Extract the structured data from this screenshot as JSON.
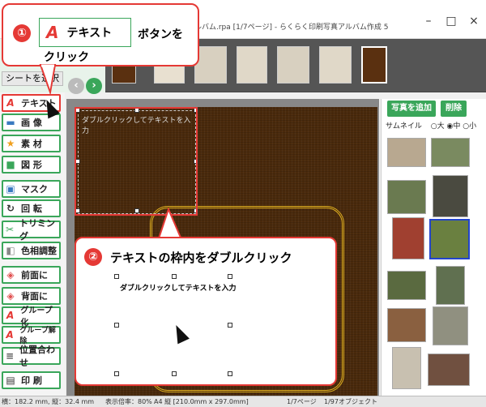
{
  "window": {
    "title": "ルバム.rpa [1/7ページ] - らくらく印刷写真アルバム作成 5",
    "minimize": "–",
    "maximize": "□",
    "close": "×"
  },
  "left_panel": {
    "sheet_select": "シートを選択"
  },
  "tools": [
    {
      "label": "テキスト",
      "icon": "text-A-icon",
      "glyph": "A",
      "selected": true
    },
    {
      "label": "画 像",
      "icon": "image-icon",
      "glyph": "▬",
      "selected": false
    },
    {
      "label": "素 材",
      "icon": "star-icon",
      "glyph": "★",
      "selected": false
    },
    {
      "label": "図 形",
      "icon": "shapes-icon",
      "glyph": "■",
      "selected": false
    },
    {
      "label": "マスク",
      "icon": "mask-icon",
      "glyph": "▣",
      "selected": false
    },
    {
      "label": "回 転",
      "icon": "rotate-icon",
      "glyph": "↻",
      "selected": false
    },
    {
      "label": "トリミング",
      "icon": "scissors-icon",
      "glyph": "✂",
      "selected": false
    },
    {
      "label": "色相調整",
      "icon": "color-icon",
      "glyph": "◧",
      "selected": false
    },
    {
      "label": "前面に",
      "icon": "bring-front-icon",
      "glyph": "◈",
      "selected": false
    },
    {
      "label": "背面に",
      "icon": "send-back-icon",
      "glyph": "◈",
      "selected": false
    },
    {
      "label": "グループ化",
      "icon": "group-icon",
      "glyph": "A",
      "selected": false
    },
    {
      "label": "グループ解除",
      "icon": "ungroup-icon",
      "glyph": "A",
      "selected": false
    },
    {
      "label": "位置合わせ",
      "icon": "align-icon",
      "glyph": "≡",
      "selected": false
    },
    {
      "label": "印 刷",
      "icon": "printer-icon",
      "glyph": "▤",
      "selected": false
    }
  ],
  "canvas": {
    "textbox_placeholder": "ダブルクリックしてテキストを入力"
  },
  "right_panel": {
    "add_photo": "写真を追加",
    "delete": "削除",
    "thumb_size_label": "サムネイル",
    "size_options": [
      "大",
      "中",
      "小"
    ],
    "selected_size": "中"
  },
  "callouts": {
    "step1_number": "①",
    "step1_button": "テキスト",
    "step1_text_a": "ボタンを",
    "step1_text_b": "クリック",
    "step2_number": "②",
    "step2_text": "テキストの枠内をダブルクリック",
    "step2_placeholder": "ダブルクリックしてテキストを入力"
  },
  "status_bar": {
    "size": "横：182.2 mm, 縦：32.4 mm",
    "zoom": "表示倍率：80%",
    "paper": "A4 縦 [210.0mm x 297.0mm]",
    "page": "1/7ページ",
    "objects": "1/97オブジェクト"
  },
  "colors": {
    "accent_green": "#3aa65a",
    "callout_red": "#e53935",
    "page_brown": "#4a2a0c",
    "frame_gold": "#e0b020"
  }
}
